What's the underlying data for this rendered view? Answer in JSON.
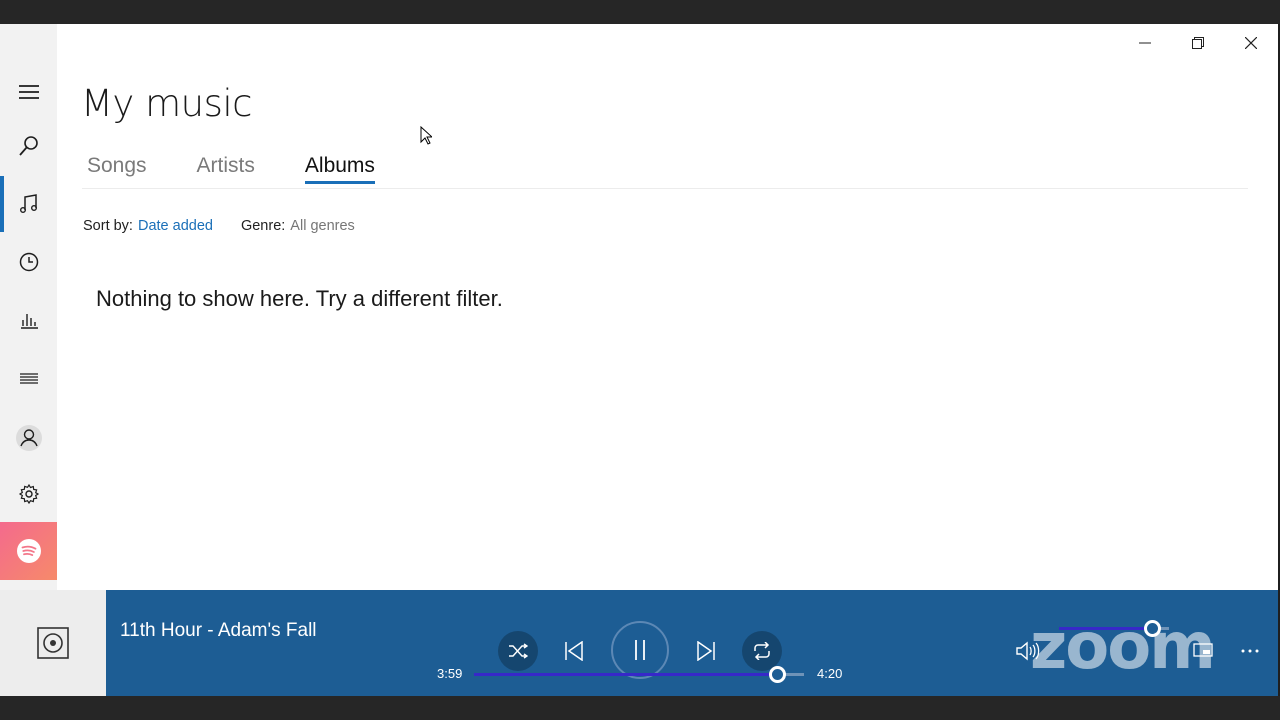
{
  "page": {
    "title": "My music"
  },
  "tabs": [
    {
      "label": "Songs"
    },
    {
      "label": "Artists"
    },
    {
      "label": "Albums"
    }
  ],
  "filters": {
    "sort_label": "Sort by:",
    "sort_value": "Date added",
    "genre_label": "Genre:",
    "genre_value": "All genres"
  },
  "content": {
    "empty_message": "Nothing to show here. Try a different filter."
  },
  "sidebar": {
    "items": [
      {
        "icon": "hamburger-icon"
      },
      {
        "icon": "search-icon"
      },
      {
        "icon": "music-note-icon",
        "active": true
      },
      {
        "icon": "recent-clock-icon"
      },
      {
        "icon": "now-playing-bars-icon"
      },
      {
        "icon": "playlists-icon"
      },
      {
        "icon": "account-icon"
      },
      {
        "icon": "settings-gear-icon"
      },
      {
        "icon": "spotify-icon"
      }
    ]
  },
  "player": {
    "now_playing": "11th Hour - Adam's Fall",
    "elapsed": "3:59",
    "duration": "4:20",
    "progress_fraction": 0.92,
    "volume_fraction": 0.85,
    "watermark": "zoom"
  },
  "colors": {
    "accent": "#1a6fb8",
    "player_bg": "#1d5d94",
    "sidebar_bg": "#f2f2f2"
  }
}
